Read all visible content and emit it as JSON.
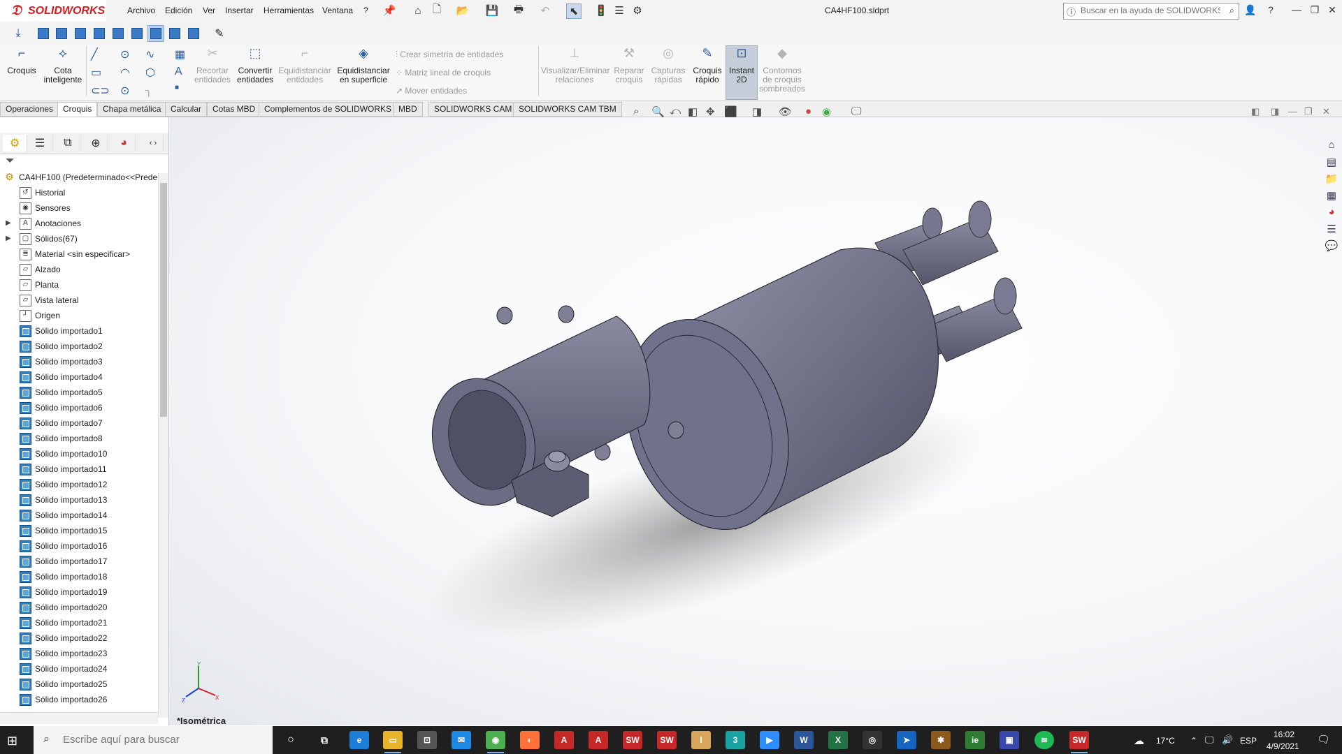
{
  "app": {
    "brand": "SOLIDWORKS",
    "document_title": "CA4HF100.sldprt"
  },
  "menu": [
    "Archivo",
    "Edición",
    "Ver",
    "Insertar",
    "Herramientas",
    "Ventana",
    "?"
  ],
  "help_search": {
    "placeholder": "Buscar en la ayuda de SOLIDWORKS"
  },
  "ribbon": {
    "croquis": "Croquis",
    "cota": "Cota inteligente",
    "recortar": "Recortar entidades",
    "convertir": "Convertir entidades",
    "equid_ent": "Equidistanciar entidades",
    "equid_sup": "Equidistanciar en superficie",
    "simetria": "Crear simetría de entidades",
    "matriz": "Matriz lineal de croquis",
    "mover": "Mover entidades",
    "visualizar": "Visualizar/Eliminar relaciones",
    "reparar": "Reparar croquis",
    "capturas": "Capturas rápidas",
    "rapido": "Croquis rápido",
    "instant": "Instant 2D",
    "contornos": "Contornos de croquis sombreados"
  },
  "tabs": [
    "Operaciones",
    "Croquis",
    "Chapa metálica",
    "Calcular",
    "Cotas MBD",
    "Complementos de SOLIDWORKS",
    "MBD",
    "SOLIDWORKS CAM",
    "SOLIDWORKS CAM TBM"
  ],
  "active_tab": "Croquis",
  "tree": {
    "root": "CA4HF100  (Predeterminado<<Prede",
    "items": [
      {
        "label": "Historial",
        "icon": "history-icon"
      },
      {
        "label": "Sensores",
        "icon": "sensor-icon"
      },
      {
        "label": "Anotaciones",
        "icon": "annotations-icon",
        "expandable": true
      },
      {
        "label": "Sólidos(67)",
        "icon": "solid-bodies-icon",
        "expandable": true
      },
      {
        "label": "Material <sin especificar>",
        "icon": "material-icon"
      },
      {
        "label": "Alzado",
        "icon": "plane-icon"
      },
      {
        "label": "Planta",
        "icon": "plane-icon"
      },
      {
        "label": "Vista lateral",
        "icon": "plane-icon"
      },
      {
        "label": "Origen",
        "icon": "origin-icon"
      }
    ],
    "imported": [
      "Sólido importado1",
      "Sólido importado2",
      "Sólido importado3",
      "Sólido importado4",
      "Sólido importado5",
      "Sólido importado6",
      "Sólido importado7",
      "Sólido importado8",
      "Sólido importado10",
      "Sólido importado11",
      "Sólido importado12",
      "Sólido importado13",
      "Sólido importado14",
      "Sólido importado15",
      "Sólido importado16",
      "Sólido importado17",
      "Sólido importado18",
      "Sólido importado19",
      "Sólido importado20",
      "Sólido importado21",
      "Sólido importado22",
      "Sólido importado23",
      "Sólido importado24",
      "Sólido importado25",
      "Sólido importado26"
    ]
  },
  "viewport": {
    "view_name": "*Isométrica"
  },
  "taskbar": {
    "search_placeholder": "Escribe aquí para buscar",
    "weather": "17°C",
    "lang": "ESP",
    "time": "16:02",
    "date": "4/9/2021"
  }
}
